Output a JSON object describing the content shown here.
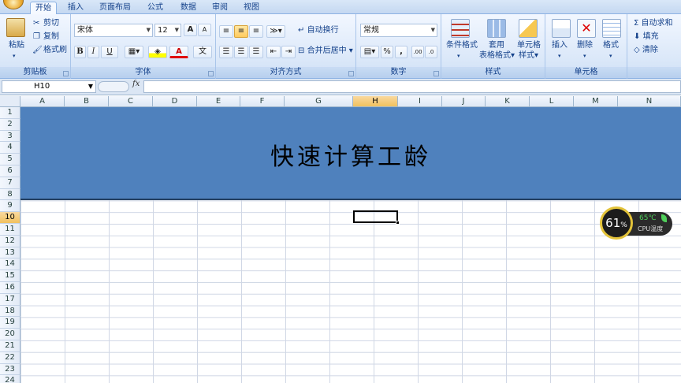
{
  "tabs": [
    {
      "label": "开始",
      "active": true
    },
    {
      "label": "插入"
    },
    {
      "label": "页面布局"
    },
    {
      "label": "公式"
    },
    {
      "label": "数据"
    },
    {
      "label": "审阅"
    },
    {
      "label": "视图"
    }
  ],
  "clipboard": {
    "paste": "粘贴",
    "cut": "剪切",
    "copy": "复制",
    "format_painter": "格式刷",
    "label": "剪贴板"
  },
  "font": {
    "name": "宋体",
    "size": "12",
    "bold": "B",
    "italic": "I",
    "underline": "U",
    "label": "字体",
    "grow": "A",
    "shrink": "A",
    "wen": "文"
  },
  "alignment": {
    "wrap": "自动换行",
    "merge": "合并后居中",
    "label": "对齐方式"
  },
  "number": {
    "format": "常规",
    "percent": "%",
    "comma": ",",
    "inc_decimal": ".00",
    "dec_decimal": ".0",
    "label": "数字"
  },
  "styles": {
    "conditional": "条件格式",
    "table_format_1": "套用",
    "table_format_2": "表格格式",
    "cell_style_1": "单元格",
    "cell_style_2": "样式",
    "label": "样式"
  },
  "cells": {
    "insert": "插入",
    "delete": "删除",
    "format": "格式",
    "label": "单元格"
  },
  "editing": {
    "autosum": "自动求和",
    "fill": "填充",
    "clear": "清除",
    "sigma": "Σ"
  },
  "formula_bar": {
    "name_box": "H10",
    "fx": "fx",
    "value": ""
  },
  "columns": [
    "A",
    "B",
    "C",
    "D",
    "E",
    "F",
    "G",
    "H",
    "I",
    "J",
    "K",
    "L",
    "M",
    "N"
  ],
  "selected_column": "H",
  "rows": [
    "1",
    "2",
    "3",
    "4",
    "5",
    "6",
    "7",
    "8",
    "9",
    "10",
    "11",
    "12",
    "13",
    "14",
    "15",
    "16",
    "17",
    "18",
    "19",
    "20",
    "21",
    "22",
    "23",
    "24"
  ],
  "selected_row": "10",
  "sheet_title": "快速计算工龄",
  "colors": {
    "title_fill": "#4f81bd",
    "selection_header": "#f1c15f"
  },
  "cpu_widget": {
    "percent": "61",
    "percent_sign": "%",
    "temp": "65℃",
    "label": "CPU温度"
  }
}
